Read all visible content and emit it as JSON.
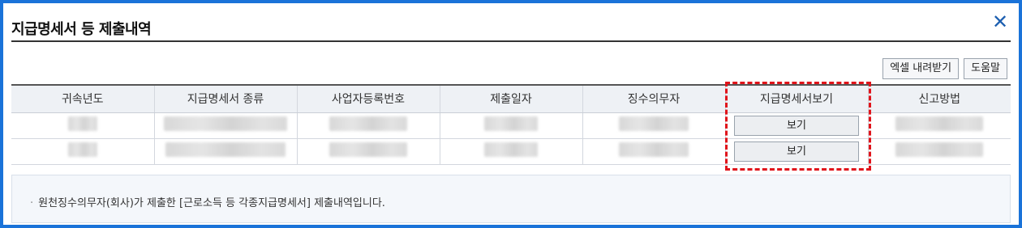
{
  "dialog": {
    "title": "지급명세서 등 제출내역",
    "close_label": "✕"
  },
  "toolbar": {
    "excel_label": "엑셀 내려받기",
    "help_label": "도움말"
  },
  "table": {
    "headers": [
      "귀속년도",
      "지급명세서 종류",
      "사업자등록번호",
      "제출일자",
      "징수의무자",
      "지급명세서보기",
      "신고방법"
    ],
    "rows": [
      {
        "view_label": "보기"
      },
      {
        "view_label": "보기"
      }
    ]
  },
  "notice": {
    "bullet": "·",
    "text": "원천징수의무자(회사)가 제출한 [근로소득 등 각종지급명세서] 제출내역입니다."
  },
  "colors": {
    "frame": "#1a73d9",
    "highlight": "#e0141b",
    "header_bg": "#eef1f5"
  }
}
